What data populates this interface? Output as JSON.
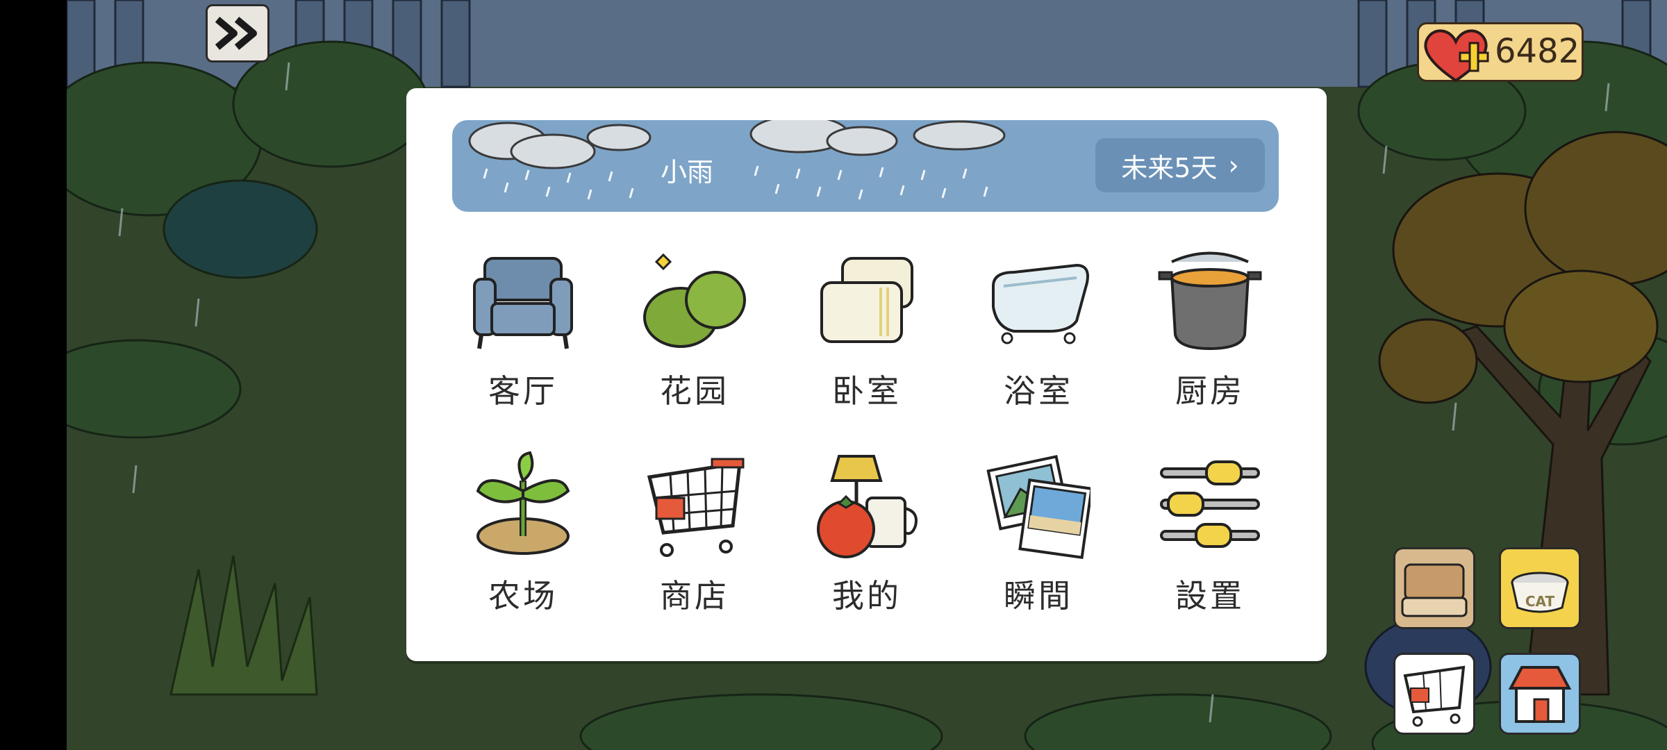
{
  "currency": {
    "amount": "6482",
    "icon": "heart-plus-icon"
  },
  "weather": {
    "condition": "小雨",
    "forecast_label": "未来5天"
  },
  "menu_items": [
    {
      "label": "客厅",
      "icon": "armchair-icon"
    },
    {
      "label": "花园",
      "icon": "bush-icon"
    },
    {
      "label": "卧室",
      "icon": "pillows-icon"
    },
    {
      "label": "浴室",
      "icon": "bathtub-icon"
    },
    {
      "label": "厨房",
      "icon": "cooking-pot-icon"
    },
    {
      "label": "农场",
      "icon": "sprout-icon"
    },
    {
      "label": "商店",
      "icon": "shopping-cart-icon"
    },
    {
      "label": "我的",
      "icon": "lamp-tomato-mug-icon"
    },
    {
      "label": "瞬間",
      "icon": "photos-icon"
    },
    {
      "label": "設置",
      "icon": "sliders-icon"
    }
  ],
  "side_buttons": {
    "food_bowl_text": "CAT"
  },
  "colors": {
    "weather_bar": "#7ea5c8",
    "forecast_button": "#6a90b6",
    "panel": "#ffffff",
    "currency_plank": "#f3d58c"
  }
}
